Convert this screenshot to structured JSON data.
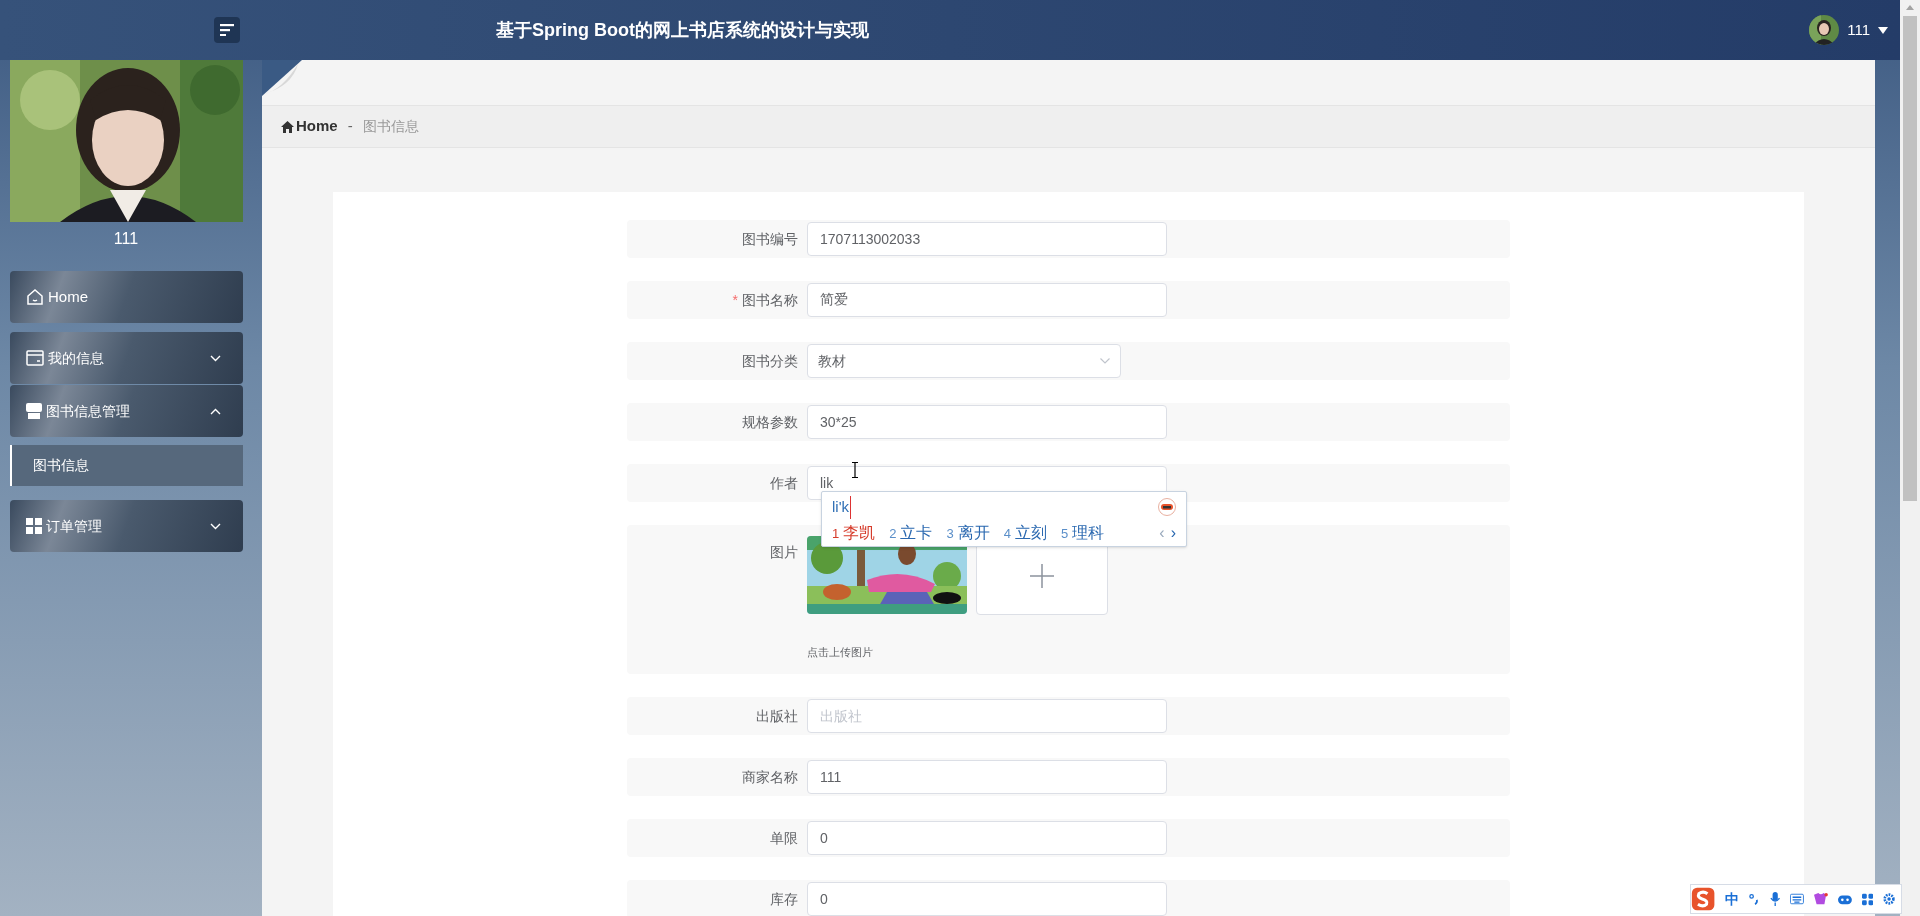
{
  "header": {
    "title": "基于Spring Boot的网上书店系统的设计与实现",
    "user": "111"
  },
  "sidebar": {
    "username": "111",
    "items": [
      {
        "label": "Home",
        "kind": "link"
      },
      {
        "label": "我的信息",
        "kind": "group",
        "expanded": false
      },
      {
        "label": "图书信息管理",
        "kind": "group",
        "expanded": true,
        "children": [
          {
            "label": "图书信息",
            "selected": true
          }
        ]
      },
      {
        "label": "订单管理",
        "kind": "group",
        "expanded": false
      }
    ]
  },
  "breadcrumb": {
    "home": "Home",
    "separator": "-",
    "current": "图书信息"
  },
  "form": {
    "required_mark": "*",
    "fields": [
      {
        "label": "图书编号",
        "kind": "text",
        "value": "1707113002033",
        "required": false
      },
      {
        "label": "图书名称",
        "kind": "text",
        "value": "简爱",
        "required": true
      },
      {
        "label": "图书分类",
        "kind": "select",
        "value": "教材",
        "required": false
      },
      {
        "label": "规格参数",
        "kind": "text",
        "value": "30*25",
        "required": false
      },
      {
        "label": "作者",
        "kind": "text",
        "value": "lik",
        "required": false,
        "ime": true
      },
      {
        "label": "图片",
        "hint": "点击上传图片",
        "required": false
      },
      {
        "label": "出版社",
        "kind": "text",
        "placeholder": "出版社",
        "required": false
      },
      {
        "label": "商家名称",
        "kind": "text",
        "value": "111",
        "required": false
      },
      {
        "label": "单限",
        "kind": "text",
        "value": "0",
        "required": false
      },
      {
        "label": "库存",
        "kind": "text",
        "value": "0",
        "required": false
      }
    ]
  },
  "ime": {
    "composition": "li'k",
    "candidates": [
      {
        "index": "1",
        "text": "李凯",
        "selected": true
      },
      {
        "index": "2",
        "text": "立卡",
        "selected": false
      },
      {
        "index": "3",
        "text": "离开",
        "selected": false
      },
      {
        "index": "4",
        "text": "立刻",
        "selected": false
      },
      {
        "index": "5",
        "text": "理科",
        "selected": false
      }
    ],
    "prev": {
      "label": "‹",
      "disabled": true
    },
    "next": {
      "label": "›",
      "disabled": false
    }
  },
  "ime_toolbar": {
    "mode": "中"
  }
}
